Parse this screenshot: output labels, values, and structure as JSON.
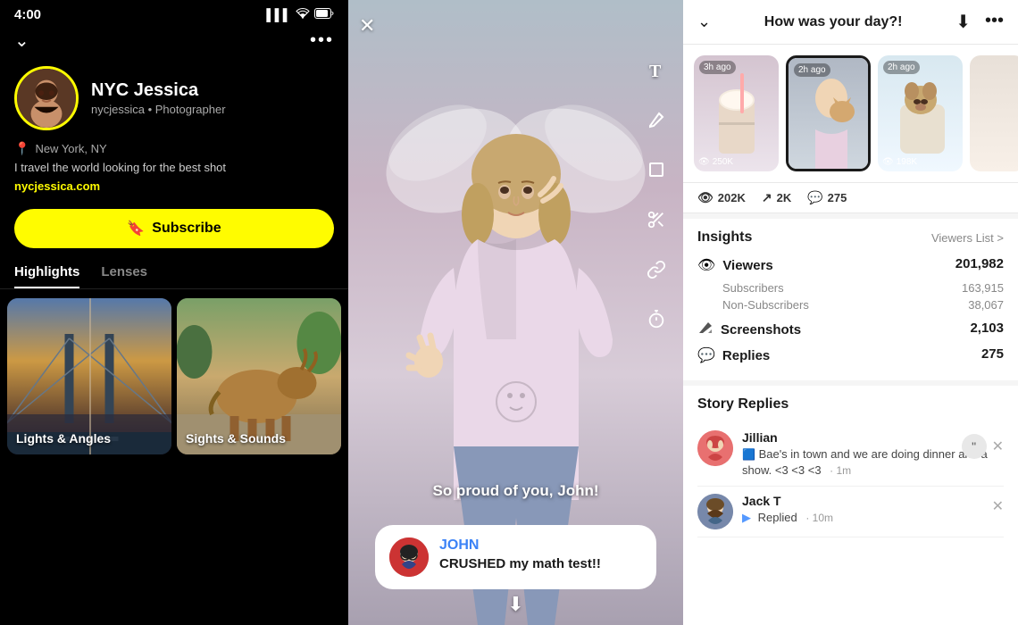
{
  "left": {
    "statusBar": {
      "time": "4:00",
      "signal": "▌▌▌",
      "wifi": "WiFi",
      "battery": "Battery"
    },
    "profile": {
      "name": "NYC Jessica",
      "handle": "nycjessica • Photographer",
      "location": "New York, NY",
      "bio": "I travel the world looking for the best shot",
      "link": "nycjessica.com",
      "subscribeLabel": "Subscribe"
    },
    "tabs": [
      {
        "id": "highlights",
        "label": "Highlights",
        "active": true
      },
      {
        "id": "lenses",
        "label": "Lenses",
        "active": false
      }
    ],
    "highlights": [
      {
        "id": "h1",
        "label": "Lights & Angles",
        "bg": "brooklyn"
      },
      {
        "id": "h2",
        "label": "Sights & Sounds",
        "bg": "bull"
      }
    ]
  },
  "middle": {
    "caption": "So proud of you, John!",
    "replyName": "JOHN",
    "replyText": "CRUSHED my math test!!",
    "tools": [
      "T",
      "✏",
      "□",
      "✂",
      "📎",
      "⏱"
    ]
  },
  "right": {
    "header": {
      "title": "How was your day?!",
      "downloadIcon": "⬇",
      "moreIcon": "•••"
    },
    "stories": [
      {
        "id": "s1",
        "time": "3h ago",
        "bg": "s1",
        "views": "250K",
        "active": false
      },
      {
        "id": "s2",
        "time": "2h ago",
        "bg": "s2",
        "views": "",
        "active": true
      },
      {
        "id": "s3",
        "time": "2h ago",
        "bg": "s3",
        "views": "198K",
        "active": false
      },
      {
        "id": "s4",
        "time": "",
        "bg": "s4",
        "views": "",
        "active": false
      }
    ],
    "totalViews": "202K",
    "screenshots": "2K",
    "totalReplies": "275",
    "insights": {
      "title": "Insights",
      "viewersListLabel": "Viewers List >",
      "rows": [
        {
          "icon": "👁",
          "label": "Viewers",
          "value": "201,982",
          "subs": [
            {
              "label": "Subscribers",
              "value": "163,915"
            },
            {
              "label": "Non-Subscribers",
              "value": "38,067"
            }
          ]
        },
        {
          "icon": "🔁",
          "label": "Screenshots",
          "value": "2,103",
          "subs": []
        },
        {
          "icon": "💬",
          "label": "Replies",
          "value": "275",
          "subs": []
        }
      ]
    },
    "storyReplies": {
      "title": "Story Replies",
      "replies": [
        {
          "id": "r1",
          "name": "Jillian",
          "avatar": "jillian",
          "avatarEmoji": "🧝",
          "text": "Bae's in town and we are doing dinner and a show. <3 <3 <3",
          "time": "1m",
          "hasQuote": true
        },
        {
          "id": "r2",
          "name": "Jack T",
          "avatar": "jack",
          "avatarEmoji": "🧔",
          "text": "Replied",
          "time": "10m",
          "hasQuote": false,
          "replied": true
        }
      ]
    }
  }
}
